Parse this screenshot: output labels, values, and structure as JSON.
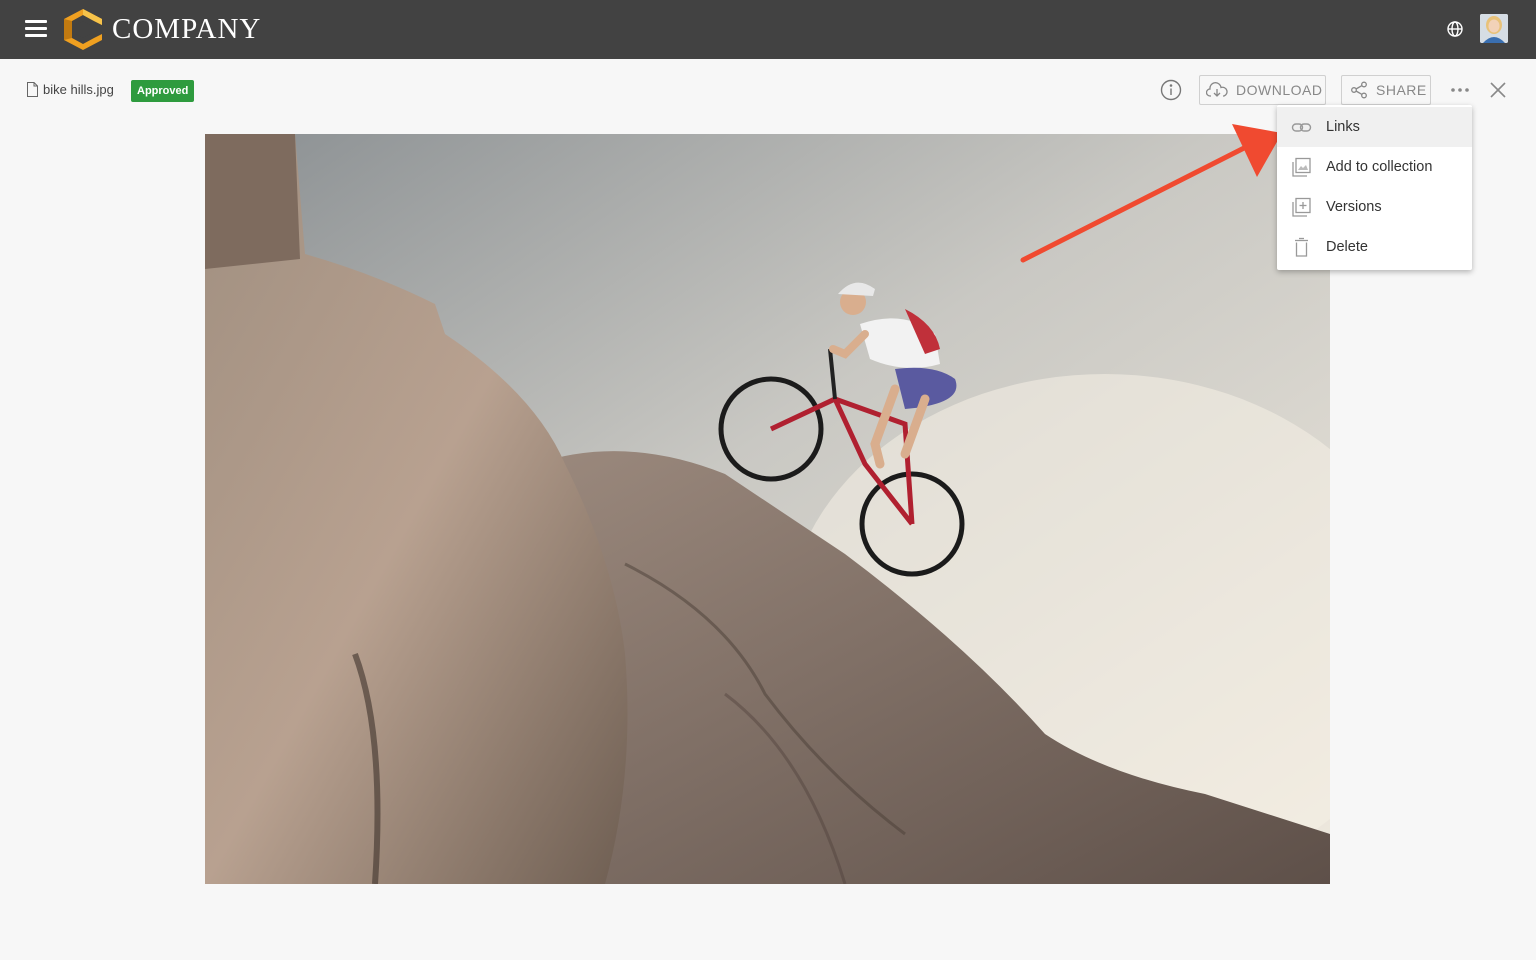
{
  "app": {
    "brand": "COMPANY"
  },
  "file": {
    "name": "bike hills.jpg",
    "status": "Approved"
  },
  "toolbar": {
    "download_label": "DOWNLOAD",
    "share_label": "SHARE"
  },
  "menu": {
    "items": [
      {
        "label": "Links",
        "icon": "link-icon",
        "highlighted": true
      },
      {
        "label": "Add to collection",
        "icon": "collection-icon"
      },
      {
        "label": "Versions",
        "icon": "versions-icon"
      },
      {
        "label": "Delete",
        "icon": "trash-icon"
      }
    ]
  },
  "colors": {
    "topbar": "#424242",
    "badge": "#2e9b3e",
    "annotation_arrow": "#f04a30",
    "logo_orange": "#f0a020"
  }
}
